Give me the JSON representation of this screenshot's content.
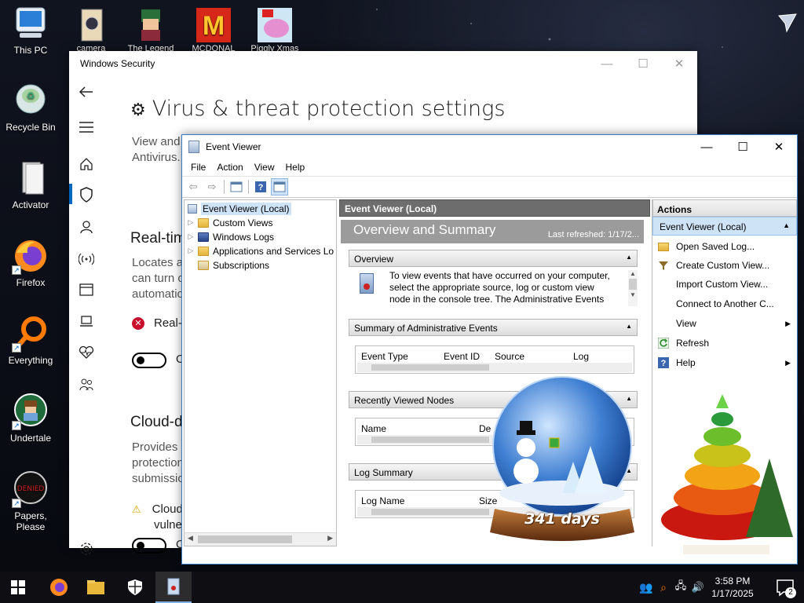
{
  "desktop": {
    "left_icons": [
      {
        "label": "This PC"
      },
      {
        "label": "Recycle Bin"
      },
      {
        "label": "Activator"
      },
      {
        "label": "Firefox"
      },
      {
        "label": "Everything"
      },
      {
        "label": "Undertale"
      },
      {
        "label": "Papers, Please"
      }
    ],
    "top_icons": [
      {
        "label": "camera"
      },
      {
        "label": "The Legend"
      },
      {
        "label": "MCDONAL"
      },
      {
        "label": "Piggly Xmas"
      }
    ]
  },
  "windows_security": {
    "title": "Windows Security",
    "page_title": "Virus & threat protection settings",
    "intro_line1": "View and",
    "intro_line2": "Antivirus.",
    "realtime_heading": "Real-tim",
    "realtime_desc1": "Locates a",
    "realtime_desc2": "can turn o",
    "realtime_desc3": "automatic",
    "realtime_status": "Real-t",
    "toggle1_label": "O",
    "cloud_heading": "Cloud-d",
    "cloud_desc1": "Provides i",
    "cloud_desc2": "protection",
    "cloud_desc3": "submissio",
    "cloud_warning1": "Cloud",
    "cloud_warning2": "vulne",
    "toggle2_label": "O"
  },
  "event_viewer": {
    "title": "Event Viewer",
    "menu": [
      "File",
      "Action",
      "View",
      "Help"
    ],
    "tree": [
      {
        "label": "Event Viewer (Local)",
        "selected": true
      },
      {
        "label": "Custom Views"
      },
      {
        "label": "Windows Logs"
      },
      {
        "label": "Applications and Services Lo"
      },
      {
        "label": "Subscriptions"
      }
    ],
    "center_header": "Event Viewer (Local)",
    "overview_title": "Overview and Summary",
    "last_refreshed": "Last refreshed: 1/17/2...",
    "overview_section": "Overview",
    "overview_text1": "To view events that have occurred on your computer,",
    "overview_text2": "select the appropriate source, log or custom view",
    "overview_text3": "node in the console tree. The Administrative Events",
    "summary_section": "Summary of Administrative Events",
    "summary_columns": [
      "Event Type",
      "Event ID",
      "Source",
      "Log"
    ],
    "recent_section": "Recently Viewed Nodes",
    "recent_columns": [
      "Name",
      "De"
    ],
    "logsum_section": "Log Summary",
    "logsum_columns": [
      "Log Name",
      "Size"
    ],
    "actions_title": "Actions",
    "actions_sub": "Event Viewer (Local)",
    "actions": [
      {
        "label": "Open Saved Log...",
        "icon": "folder-icon"
      },
      {
        "label": "Create Custom View...",
        "icon": "filter-icon"
      },
      {
        "label": "Import Custom View...",
        "icon": ""
      },
      {
        "label": "Connect to Another C...",
        "icon": ""
      },
      {
        "label": "View",
        "icon": "",
        "submenu": true
      },
      {
        "label": "Refresh",
        "icon": "refresh-icon"
      },
      {
        "label": "Help",
        "icon": "help-icon",
        "submenu": true
      }
    ]
  },
  "gadget": {
    "countdown": "341 days"
  },
  "taskbar": {
    "time": "3:58 PM",
    "date": "1/17/2025",
    "notifications": "2"
  }
}
